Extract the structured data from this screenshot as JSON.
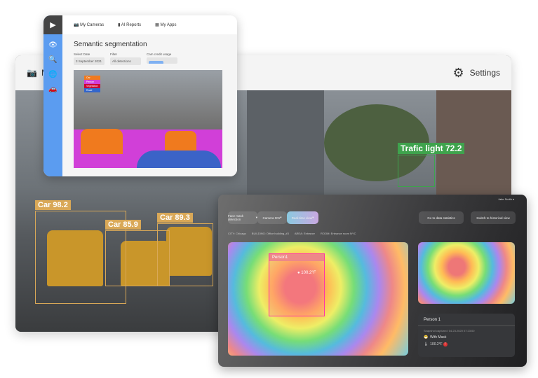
{
  "back_window": {
    "title_partial": "M",
    "settings_label": "Settings"
  },
  "detections": [
    {
      "label": "Car 98.2"
    },
    {
      "label": "Car 85.9"
    },
    {
      "label": "Car 89.3"
    },
    {
      "label": "Trafic light 72.2"
    }
  ],
  "segmentation": {
    "nav": [
      "My Cameras",
      "AI Reports",
      "My Apps"
    ],
    "title": "Semantic segmentation",
    "select_date_label": "Select Date",
    "select_date_value": "3 September 2021",
    "filter_label": "Filter",
    "filter_value": "All detections",
    "credit_label": "Cam credit usage",
    "credit_usage_fraction": 0.55,
    "legend": [
      "Car",
      "Person",
      "Vegetation",
      "Road"
    ]
  },
  "heatmap": {
    "user": "Jake Smith",
    "dropdowns": [
      "Face mask detection",
      "Camera 001",
      "Real-time view"
    ],
    "buttons": [
      "Go to data statistics",
      "Switch to historical view"
    ],
    "breadcrumbs": [
      "CITY: Chicago",
      "BUILDING: Office building_#3",
      "AREA: Entrance",
      "ROOM: Entrance room NYC"
    ],
    "person_label": "Person1",
    "temp_overlay": "100.2°F",
    "card": {
      "title": "Person 1",
      "snapshot": "Snapshot captured: 04.23.2020 07:23:00",
      "mask": "With Mask",
      "temp": "100.2°F",
      "alert": "!"
    }
  }
}
